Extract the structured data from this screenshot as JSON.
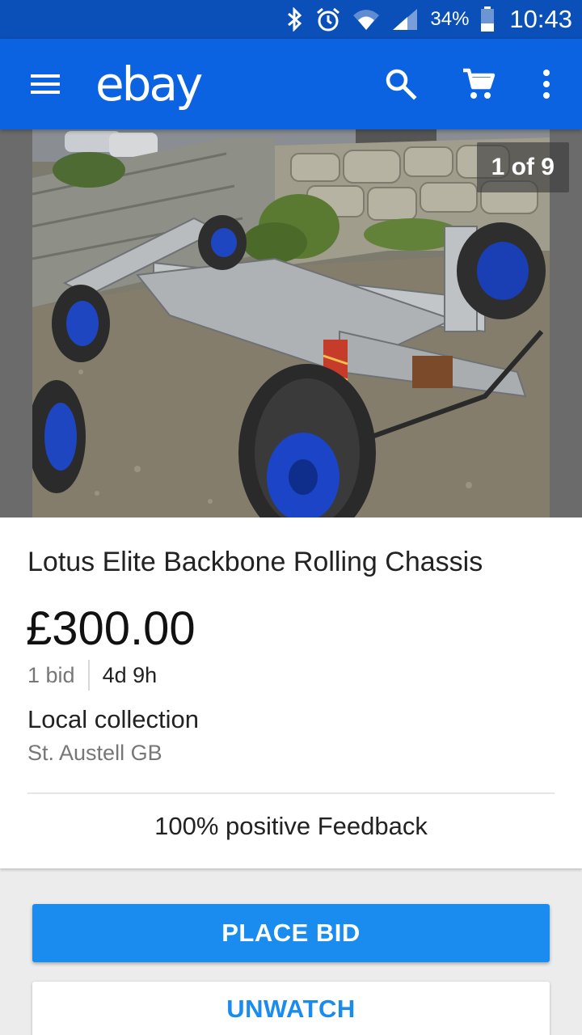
{
  "status_bar": {
    "battery_pct": "34%",
    "time": "10:43",
    "icons": [
      "bluetooth-icon",
      "alarm-icon",
      "wifi-icon",
      "signal-icon",
      "battery-icon"
    ]
  },
  "app_bar": {
    "logo": "ebay",
    "icons": [
      "menu-icon",
      "search-icon",
      "cart-icon",
      "more-vert-icon"
    ]
  },
  "gallery": {
    "counter": "1 of 9"
  },
  "item": {
    "title": "Lotus Elite Backbone Rolling Chassis",
    "price": "£300.00",
    "bids": "1 bid",
    "time_left": "4d 9h",
    "delivery": "Local collection",
    "location": "St. Austell GB",
    "feedback": "100% positive Feedback"
  },
  "actions": {
    "place_bid": "PLACE BID",
    "unwatch": "UNWATCH"
  },
  "colors": {
    "status_bar": "#0b4fb8",
    "app_bar": "#0b63e1",
    "primary_button": "#1a8cf0",
    "page_background": "#ececec"
  }
}
